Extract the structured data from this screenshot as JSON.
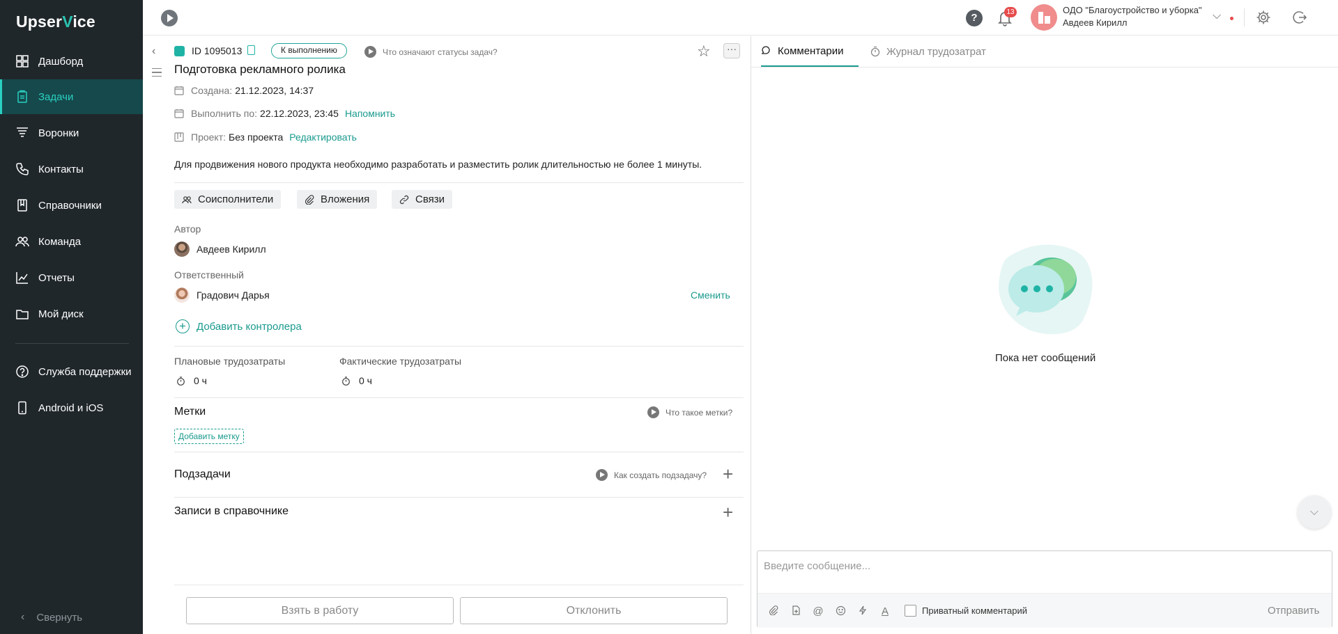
{
  "sidebar": {
    "logo_a": "Upser",
    "logo_v": "V",
    "logo_b": "ice",
    "items": [
      {
        "label": "Дашборд",
        "icon": "dashboard-icon"
      },
      {
        "label": "Задачи",
        "icon": "tasks-icon",
        "active": true
      },
      {
        "label": "Воронки",
        "icon": "funnel-icon"
      },
      {
        "label": "Контакты",
        "icon": "contacts-icon"
      },
      {
        "label": "Справочники",
        "icon": "book-icon"
      },
      {
        "label": "Команда",
        "icon": "team-icon"
      },
      {
        "label": "Отчеты",
        "icon": "chart-icon"
      },
      {
        "label": "Мой диск",
        "icon": "folder-icon"
      }
    ],
    "extra": [
      {
        "label": "Служба поддержки",
        "icon": "help-icon"
      },
      {
        "label": "Android и iOS",
        "icon": "phone-icon"
      }
    ],
    "collapse_label": "Свернуть"
  },
  "topbar": {
    "notifications_count": "13",
    "org_name": "ОДО \"Благоустройство и уборка\"",
    "user_name": "Авдеев Кирилл"
  },
  "task": {
    "id": "ID 1095013",
    "status": "К выполнению",
    "status_help": "Что означают статусы задач?",
    "title": "Подготовка рекламного ролика",
    "created_label": "Создана:",
    "created_value": "21.12.2023, 14:37",
    "due_label": "Выполнить по:",
    "due_value": "22.12.2023, 23:45",
    "remind_link": "Напомнить",
    "project_label": "Проект:",
    "project_value": "Без проекта",
    "edit_link": "Редактировать",
    "description": "Для продвижения нового продукта необходимо разработать и разместить ролик длительностью не более 1 минуты.",
    "chips": {
      "coexecutors": "Соисполнители",
      "attachments": "Вложения",
      "links": "Связи"
    },
    "author_label": "Автор",
    "author_name": "Авдеев Кирилл",
    "responsible_label": "Ответственный",
    "responsible_name": "Градович Дарья",
    "change_link": "Сменить",
    "add_controller": "Добавить контролера",
    "planned_label": "Плановые трудозатраты",
    "planned_value": "0 ч",
    "actual_label": "Фактические трудозатраты",
    "actual_value": "0 ч",
    "tags_title": "Метки",
    "tags_help": "Что такое метки?",
    "add_tag": "Добавить метку",
    "subtasks_title": "Подзадачи",
    "subtasks_help": "Как создать подзадачу?",
    "records_title": "Записи в справочнике",
    "take_button": "Взять в работу",
    "reject_button": "Отклонить"
  },
  "comments": {
    "tab_comments": "Комментарии",
    "tab_journal": "Журнал трудозатрат",
    "empty_text": "Пока нет сообщений",
    "input_placeholder": "Введите сообщение...",
    "private_label": "Приватный комментарий",
    "send_label": "Отправить"
  },
  "colors": {
    "accent": "#1a9a8e",
    "sidebar_bg": "#20272b",
    "active_bg": "#15494c",
    "badge": "#e74c4c"
  }
}
